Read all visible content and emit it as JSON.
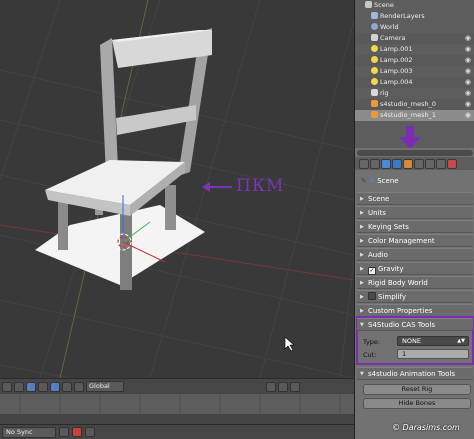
{
  "viewport": {
    "annotation_text": "ПКМ"
  },
  "viewport_header": {
    "orientation": "Global"
  },
  "timeline": {
    "sync_label": "No Sync"
  },
  "outliner": {
    "items": [
      {
        "label": "Scene",
        "icon": "scene-icon"
      },
      {
        "label": "RenderLayers",
        "icon": "render-layers-icon"
      },
      {
        "label": "World",
        "icon": "world-icon"
      },
      {
        "label": "Camera",
        "icon": "camera-icon"
      },
      {
        "label": "Lamp.001",
        "icon": "lamp-icon"
      },
      {
        "label": "Lamp.002",
        "icon": "lamp-icon"
      },
      {
        "label": "Lamp.003",
        "icon": "lamp-icon"
      },
      {
        "label": "Lamp.004",
        "icon": "lamp-icon"
      },
      {
        "label": "rig",
        "icon": "armature-icon"
      },
      {
        "label": "s4studio_mesh_0",
        "icon": "mesh-icon"
      },
      {
        "label": "s4studio_mesh_1",
        "icon": "mesh-icon"
      }
    ]
  },
  "properties": {
    "context_label": "Scene",
    "panels": [
      {
        "label": "Scene"
      },
      {
        "label": "Units"
      },
      {
        "label": "Keying Sets"
      },
      {
        "label": "Color Management"
      },
      {
        "label": "Audio"
      },
      {
        "label": "Gravity"
      },
      {
        "label": "Rigid Body World"
      },
      {
        "label": "Simplify"
      },
      {
        "label": "Custom Properties"
      }
    ],
    "cas_tools": {
      "title": "S4Studio CAS Tools",
      "type_label": "Type:",
      "type_value": "NONE",
      "cut_label": "Cut:",
      "cut_value": "1"
    },
    "animation_tools": {
      "title": "s4studio Animation Tools",
      "reset_rig_label": "Reset Rig",
      "hide_bones_label": "Hide Bones"
    }
  },
  "watermark": "© Darasims.com",
  "colors": {
    "highlight": "#7b2eb4",
    "active_tab": "#3f78c8"
  }
}
